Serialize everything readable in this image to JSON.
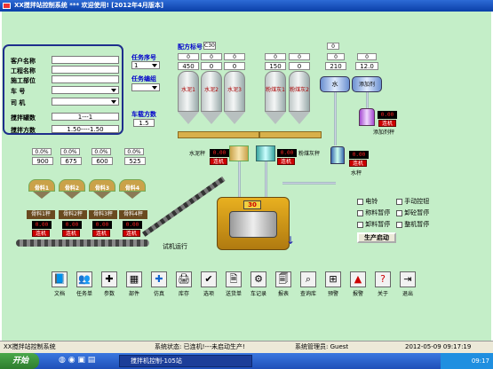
{
  "window": {
    "title": "XX搅拌站控制系统 *** 欢迎使用! [2012年4月版本]"
  },
  "form": {
    "labels": [
      "客户名称",
      "工程名称",
      "施工部位",
      "车 号",
      "司 机",
      "搅拌罐数",
      "搅拌方数"
    ],
    "tank_count": "1---1",
    "volume": "1.50----1.50",
    "task_label": "任务序号",
    "task_value": "1",
    "station_label": "任务编组",
    "batch_label": "车载方数",
    "batch_value": "1.5"
  },
  "recipe": {
    "label": "配方标号",
    "value": "C30"
  },
  "silos": [
    {
      "label": "水泥1",
      "pct": "0",
      "value": "450"
    },
    {
      "label": "水泥2",
      "pct": "0",
      "value": "0"
    },
    {
      "label": "水泥3",
      "pct": "0",
      "value": "0"
    },
    {
      "label": "粉煤灰1",
      "pct": "0",
      "value": "150"
    },
    {
      "label": "粉煤灰2",
      "pct": "0",
      "value": "0"
    }
  ],
  "water": {
    "label": "水",
    "pct": "0",
    "value": "210",
    "scale": "水秤"
  },
  "additive": {
    "label": "添加剂",
    "pct": "0",
    "value": "12.0",
    "scale": "添加剂秤"
  },
  "scales": {
    "cement": "水泥秤",
    "flyash": "粉煤灰秤"
  },
  "led_value": "0.00",
  "connected": "连机",
  "aggregates": [
    {
      "label": "骨料1",
      "pct": "0.0%",
      "value": "900",
      "weigh": "骨料1秤"
    },
    {
      "label": "骨料2",
      "pct": "0.0%",
      "value": "675",
      "weigh": "骨料2秤"
    },
    {
      "label": "骨料3",
      "pct": "0.0%",
      "value": "600",
      "weigh": "骨料3秤"
    },
    {
      "label": "骨料4",
      "pct": "0.0%",
      "value": "525",
      "weigh": "骨料4秤"
    }
  ],
  "mixer": {
    "value": "30"
  },
  "trial": "试机运行",
  "controls": [
    {
      "label": "电铃"
    },
    {
      "label": "手动控钮"
    },
    {
      "label": "称料暂停"
    },
    {
      "label": "卸砼暂停"
    },
    {
      "label": "卸料暂停"
    },
    {
      "label": "整机暂停"
    }
  ],
  "start_button": "生产启动",
  "toolbar": [
    {
      "label": "文档",
      "icon": "doc-icon"
    },
    {
      "label": "任务单",
      "icon": "task-icon"
    },
    {
      "label": "参数",
      "icon": "param-icon"
    },
    {
      "label": "部件",
      "icon": "part-icon"
    },
    {
      "label": "仿真",
      "icon": "sim-icon"
    },
    {
      "label": "库存",
      "icon": "stock-icon"
    },
    {
      "label": "选项",
      "icon": "option-icon"
    },
    {
      "label": "送货单",
      "icon": "delivery-icon"
    },
    {
      "label": "车记录",
      "icon": "car-icon"
    },
    {
      "label": "报表",
      "icon": "report-icon"
    },
    {
      "label": "查询库",
      "icon": "query-icon"
    },
    {
      "label": "预警",
      "icon": "alarm-icon"
    },
    {
      "label": "报警",
      "icon": "warn-icon"
    },
    {
      "label": "关于",
      "icon": "about-icon"
    },
    {
      "label": "退出",
      "icon": "exit-icon"
    }
  ],
  "status": {
    "app": "XX搅拌站控制系统",
    "state": "系统状态: 已连机!---未启动生产!",
    "admin": "系统管理员: Guest",
    "time": "2012-05-09 09:17:19"
  },
  "taskbar": {
    "start": "开始",
    "window": "搅拌机控制-105站",
    "clock": "09:17"
  }
}
